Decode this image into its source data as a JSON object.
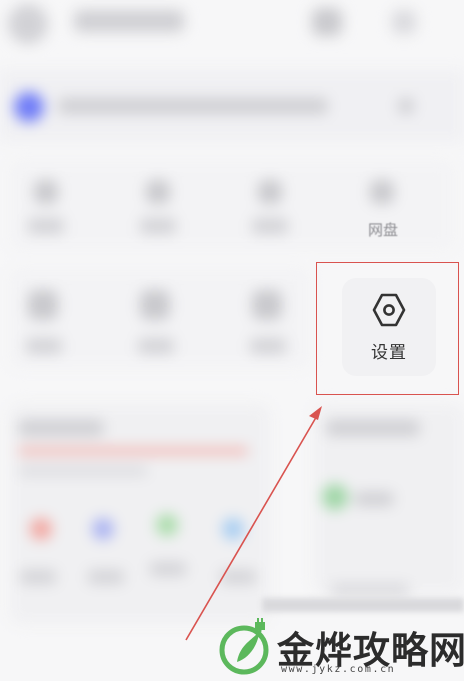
{
  "grid": {
    "row1_visible_label": "网盘"
  },
  "settings_tile": {
    "icon": "hexagon-gear-icon",
    "label": "设置"
  },
  "colors": {
    "highlight": "#d9534f",
    "accent_blue": "#6f7cf7"
  },
  "watermark": {
    "title": "金烨攻略网",
    "url": "www.jykz.com.cn"
  }
}
